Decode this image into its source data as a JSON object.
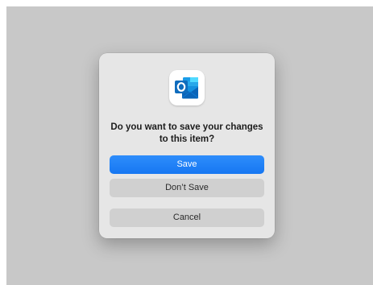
{
  "dialog": {
    "app_icon": "outlook-icon",
    "message": "Do you want to save your changes to this item?",
    "buttons": {
      "save": "Save",
      "dont_save": "Don’t Save",
      "cancel": "Cancel"
    }
  },
  "colors": {
    "backdrop": "#c8c8c8",
    "dialog_background": "#e6e6e6",
    "primary_button": "#1a7cf5",
    "secondary_button": "#d0d0d0",
    "outlook_blue": "#0a64b8"
  }
}
